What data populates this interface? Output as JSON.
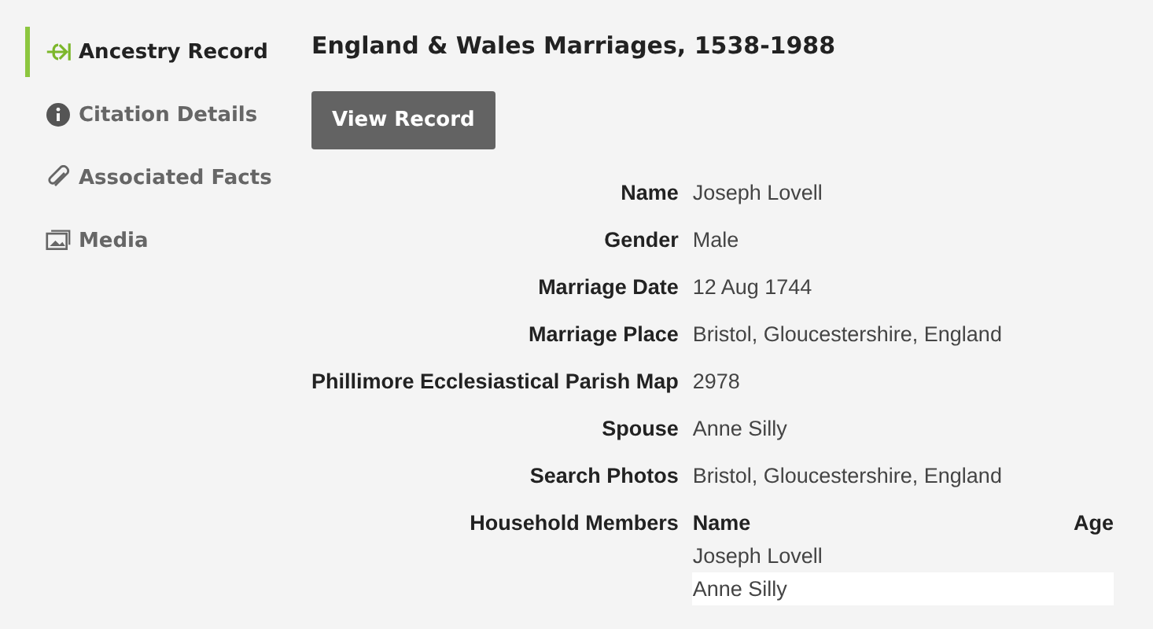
{
  "sidebar": {
    "items": [
      {
        "label": "Ancestry Record",
        "kind": "record",
        "selected": true
      },
      {
        "label": "Citation Details",
        "kind": "info",
        "selected": false
      },
      {
        "label": "Associated Facts",
        "kind": "clip",
        "selected": false
      },
      {
        "label": "Media",
        "kind": "media",
        "selected": false
      }
    ]
  },
  "record": {
    "title": "England & Wales Marriages, 1538-1988",
    "button": "View Record",
    "fields": [
      {
        "label": "Name",
        "value": "Joseph Lovell"
      },
      {
        "label": "Gender",
        "value": "Male"
      },
      {
        "label": "Marriage Date",
        "value": "12 Aug 1744"
      },
      {
        "label": "Marriage Place",
        "value": "Bristol, Gloucestershire, England"
      },
      {
        "label": "Phillimore Ecclesiastical Parish Map",
        "value": "2978"
      },
      {
        "label": "Spouse",
        "value": "Anne Silly"
      },
      {
        "label": "Search Photos",
        "value": "Bristol, Gloucestershire, England"
      }
    ],
    "household": {
      "label": "Household Members",
      "columns": [
        "Name",
        "Age"
      ],
      "rows": [
        {
          "name": "Joseph Lovell"
        },
        {
          "name": "Anne Silly"
        }
      ]
    }
  }
}
